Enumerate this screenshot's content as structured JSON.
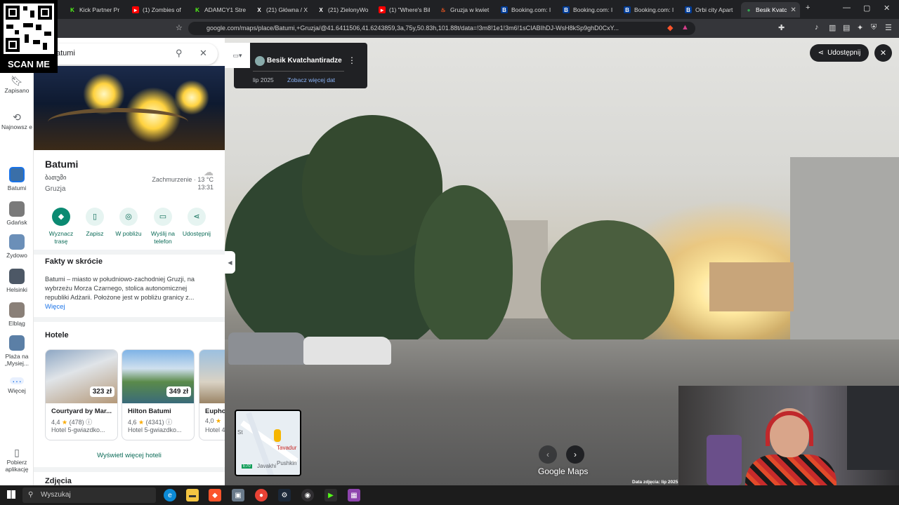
{
  "browser": {
    "tabs": [
      {
        "label": "Kick Partner Pr",
        "icon": "kick-icon",
        "color": "#53fc18"
      },
      {
        "label": "(1) Zombies of",
        "icon": "youtube-icon",
        "color": "#ff0000"
      },
      {
        "label": "ADAMCY1 Stre",
        "icon": "kick-icon",
        "color": "#53fc18"
      },
      {
        "label": "(21) Główna / X",
        "icon": "x-icon",
        "color": "#ffffff"
      },
      {
        "label": "(21) ZielonyWo",
        "icon": "x-icon",
        "color": "#ffffff"
      },
      {
        "label": "(1) \"Where's Bil",
        "icon": "youtube-icon",
        "color": "#ff0000"
      },
      {
        "label": "Gruzja w kwiet",
        "icon": "fire-icon",
        "color": "#ff5a1f"
      },
      {
        "label": "Booking.com: I",
        "icon": "booking-icon",
        "color": "#003b95"
      },
      {
        "label": "Booking.com: I",
        "icon": "booking-icon",
        "color": "#003b95"
      },
      {
        "label": "Booking.com: I",
        "icon": "booking-icon",
        "color": "#003b95"
      },
      {
        "label": "Orbi city Apart",
        "icon": "booking-icon",
        "color": "#003b95"
      },
      {
        "label": "Besik Kvatc",
        "icon": "maps-icon",
        "color": "#34a853"
      }
    ],
    "url": "google.com/maps/place/Batumi,+Gruzja/@41.6411506,41.6243859,3a,75y,50.83h,101.88t/data=!3m8!1e1!3m6!1sCIABIhDJ-WsH8kSp9ghD0CxY..."
  },
  "overlay": {
    "scan_label": "SCAN ME"
  },
  "rail": {
    "items": [
      {
        "label": "Zapisano",
        "icon": "bookmark-icon"
      },
      {
        "label": "Najnowsz e",
        "icon": "history-icon"
      },
      {
        "label": "Batumi",
        "thumb": "#3a6fa8"
      },
      {
        "label": "Gdańsk",
        "thumb": "#7a7a7a"
      },
      {
        "label": "Żydowo",
        "thumb": "#6b8fb8"
      },
      {
        "label": "Helsinki",
        "thumb": "#4d5866"
      },
      {
        "label": "Elbląg",
        "thumb": "#8a8078"
      },
      {
        "label": "Plaża na „Mysiej...",
        "thumb": "#5b7fa6"
      },
      {
        "label": "Więcej",
        "icon": "more-icon"
      },
      {
        "label": "Pobierz aplikację",
        "icon": "phone-icon"
      }
    ]
  },
  "panel": {
    "search_query": "atumi",
    "place": {
      "name": "Batumi",
      "native_name": "ბათუმი",
      "country": "Gruzja",
      "weather": "Zachmurzenie · 13 °C",
      "time": "13:31"
    },
    "actions": [
      {
        "label": "Wyznacz trasę",
        "icon": "directions-icon"
      },
      {
        "label": "Zapisz",
        "icon": "bookmark-icon"
      },
      {
        "label": "W pobliżu",
        "icon": "nearby-icon"
      },
      {
        "label": "Wyślij na telefon",
        "icon": "send-to-phone-icon"
      },
      {
        "label": "Udostępnij",
        "icon": "share-icon"
      }
    ],
    "facts_title": "Fakty w skrócie",
    "facts_text": "Batumi – miasto w południowo-zachodniej Gruzji, na wybrzeżu Morza Czarnego, stolica autonomicznej republiki Adżarii. Położone jest w pobliżu granicy z...",
    "facts_more": "Więcej",
    "hotels_title": "Hotele",
    "hotels": [
      {
        "name": "Courtyard by Mar...",
        "rating": "4,4",
        "reviews": "(478)",
        "category": "Hotel 5-gwiazdko...",
        "price": "323 zł"
      },
      {
        "name": "Hilton Batumi",
        "rating": "4,6",
        "reviews": "(4341)",
        "category": "Hotel 5-gwiazdko...",
        "price": "349 zł"
      },
      {
        "name": "Eupho",
        "rating": "4,0",
        "reviews": "",
        "category": "Hotel 4",
        "price": ""
      }
    ],
    "more_hotels": "Wyświetl więcej hoteli",
    "photos_title": "Zdjęcia"
  },
  "streetview": {
    "author": "Besik Kvatchantiradze",
    "capture_date": "lip 2025",
    "see_more_dates": "Zobacz więcej dat",
    "share_label": "Udostępnij",
    "brand": "Google Maps",
    "image_date": "Data zdjęcia: lip 2025",
    "minimap_labels": [
      "Tavadur",
      "Pushkin",
      "Javakhi",
      "St",
      "E70"
    ]
  },
  "taskbar": {
    "search_label": "Wyszukaj"
  }
}
